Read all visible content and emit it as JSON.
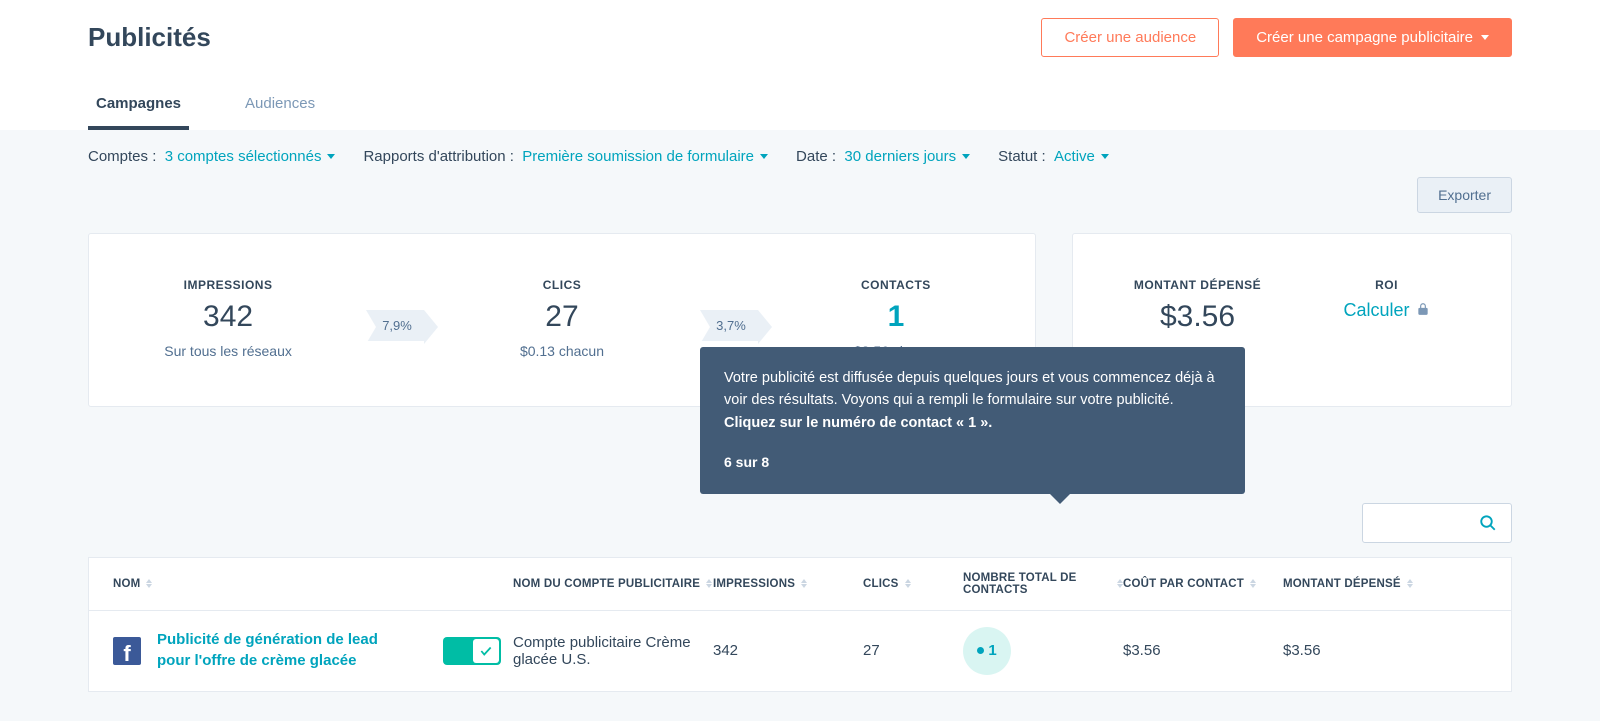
{
  "header": {
    "title": "Publicités",
    "create_audience": "Créer une audience",
    "create_campaign": "Créer une campagne publicitaire"
  },
  "tabs": {
    "campaigns": "Campagnes",
    "audiences": "Audiences"
  },
  "filters": {
    "accounts_label": "Comptes :",
    "accounts_value": "3 comptes sélectionnés",
    "attribution_label": "Rapports d'attribution :",
    "attribution_value": "Première soumission de formulaire",
    "date_label": "Date :",
    "date_value": "30 derniers jours",
    "status_label": "Statut :",
    "status_value": "Active",
    "export": "Exporter"
  },
  "funnel": {
    "impressions": {
      "label": "IMPRESSIONS",
      "value": "342",
      "sub": "Sur tous les réseaux"
    },
    "rate1": "7,9%",
    "clicks": {
      "label": "CLICS",
      "value": "27",
      "sub": "$0.13 chacun"
    },
    "rate2": "3,7%",
    "contacts": {
      "label": "CONTACTS",
      "value": "1",
      "sub": "$3.56 chacun"
    }
  },
  "summary": {
    "spent_label": "MONTANT DÉPENSÉ",
    "spent_value": "$3.56",
    "roi_label": "ROI",
    "roi_action": "Calculer"
  },
  "tooltip": {
    "text_a": "Votre publicité est diffusée depuis quelques jours et vous commencez déjà à voir des résultats. Voyons qui a rempli le formulaire sur votre publicité. ",
    "text_b": "Cliquez sur le numéro de contact « 1 ».",
    "step": "6 sur 8"
  },
  "table": {
    "headers": {
      "name": "NOM",
      "account": "NOM DU COMPTE PUBLICITAIRE",
      "impressions": "IMPRESSIONS",
      "clics": "CLICS",
      "contacts": "NOMBRE TOTAL DE CONTACTS",
      "cost": "COÛT PAR CONTACT",
      "spent": "MONTANT DÉPENSÉ"
    },
    "row": {
      "ad_name": "Publicité de génération de lead pour l'offre de crème glacée",
      "account": "Compte publicitaire Crème glacée U.S.",
      "impressions": "342",
      "clics": "27",
      "contacts": "1",
      "cost": "$3.56",
      "spent": "$3.56"
    }
  }
}
